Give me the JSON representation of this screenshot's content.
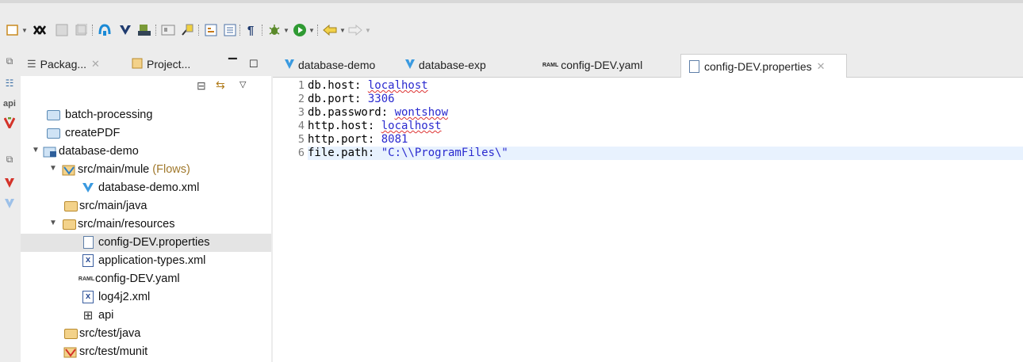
{
  "toolbar": {
    "icons": [
      "new-icon",
      "link-icon",
      "save-icon",
      "save-all-icon",
      "connect-icon",
      "mule-icon",
      "deploy-icon",
      "console-icon",
      "open-type-icon",
      "task-icon",
      "outline-icon",
      "pilcrow-icon",
      "debug-icon",
      "run-icon",
      "back-icon",
      "forward-icon"
    ]
  },
  "left_strip": {
    "api_label": "api"
  },
  "explorer": {
    "tabs": [
      {
        "label": "Packag...",
        "icon": "package-explorer-icon"
      },
      {
        "label": "Project...",
        "icon": "project-explorer-icon"
      }
    ],
    "tree": [
      {
        "label": "batch-processing",
        "icon": "folder-icon"
      },
      {
        "label": "createPDF",
        "icon": "folder-icon"
      },
      {
        "label": "database-demo",
        "icon": "project-icon"
      },
      {
        "label": "src/main/mule",
        "suffix": "(Flows)",
        "icon": "mule-folder-icon"
      },
      {
        "label": "database-demo.xml",
        "icon": "mule-file-icon"
      },
      {
        "label": "src/main/java",
        "icon": "package-folder-icon"
      },
      {
        "label": "src/main/resources",
        "icon": "package-folder-icon"
      },
      {
        "label": "config-DEV.properties",
        "icon": "properties-file-icon"
      },
      {
        "label": "application-types.xml",
        "icon": "xml-file-icon"
      },
      {
        "label": "config-DEV.yaml",
        "icon": "raml-file-icon"
      },
      {
        "label": "log4j2.xml",
        "icon": "xml-file-icon"
      },
      {
        "label": "api",
        "icon": "api-folder-icon"
      },
      {
        "label": "src/test/java",
        "icon": "package-folder-icon"
      },
      {
        "label": "src/test/munit",
        "icon": "munit-folder-icon"
      }
    ]
  },
  "editor": {
    "tabs": [
      {
        "label": "database-demo",
        "icon": "mule-icon"
      },
      {
        "label": "database-exp",
        "icon": "mule-icon"
      },
      {
        "label": "config-DEV.yaml",
        "icon": "raml-icon"
      },
      {
        "label": "config-DEV.properties",
        "icon": "properties-icon",
        "active": true
      }
    ],
    "lines": [
      {
        "num": "1",
        "key": "db.host: ",
        "value": "localhost"
      },
      {
        "num": "2",
        "key": "db.port: ",
        "value": "3306"
      },
      {
        "num": "3",
        "key": "db.password: ",
        "value": "wontshow"
      },
      {
        "num": "4",
        "key": "http.host: ",
        "value": "localhost"
      },
      {
        "num": "5",
        "key": "http.port: ",
        "value": "8081"
      },
      {
        "num": "6",
        "key": "file.path: ",
        "value": "\"C:\\\\ProgramFiles\\\""
      }
    ]
  },
  "colors": {
    "accent": "#2a2acf",
    "selection": "#e4e4e4",
    "current_line": "#e8f2fe"
  }
}
